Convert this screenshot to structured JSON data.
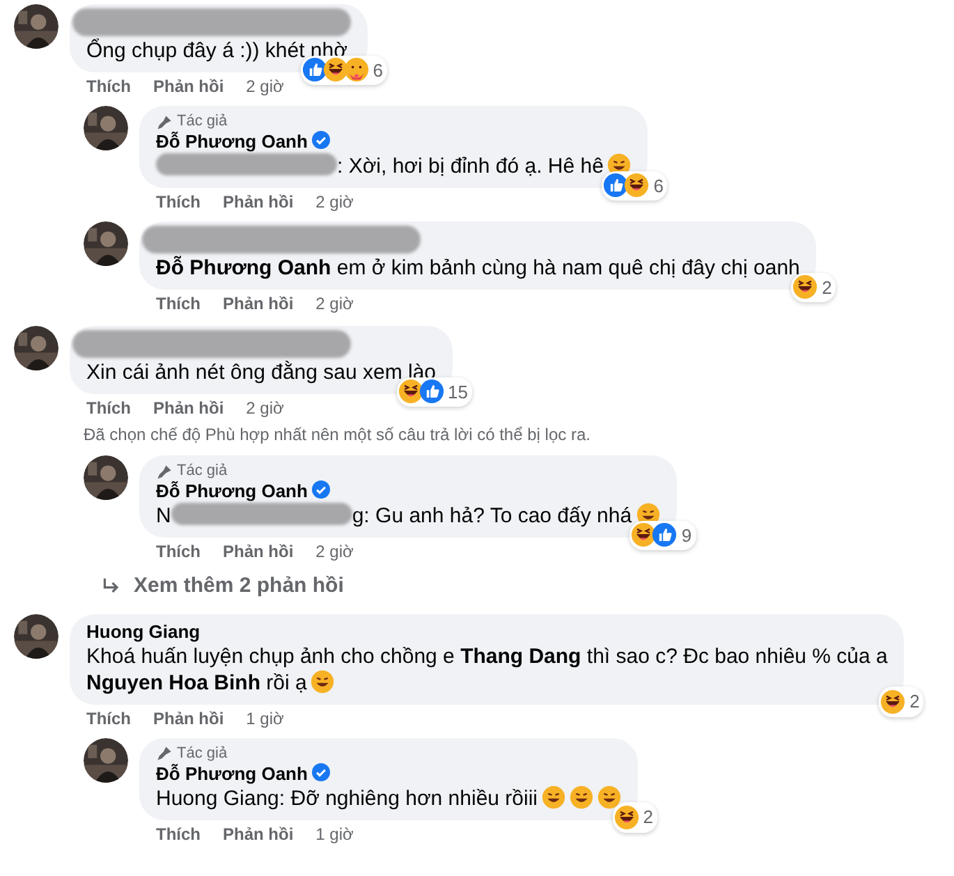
{
  "thread": [
    {
      "author_hidden": true,
      "segments": [
        {
          "kind": "text",
          "text": "Ổng chụp đây á :)) khét nhờ"
        }
      ],
      "reactions": [
        {
          "kind": "like"
        },
        {
          "kind": "haha"
        },
        {
          "kind": "care"
        }
      ],
      "reaction_count": "6",
      "actions": [
        "Thích",
        "Phản hồi"
      ],
      "time": "2 giờ",
      "replies": [
        {
          "author": "Đỗ Phương Oanh",
          "verified": true,
          "badge": "Tác giả",
          "segments": [
            {
              "kind": "blur"
            },
            {
              "kind": "text",
              "text": ": Xời, hơi bị đỉnh đó ạ. Hê hê"
            },
            {
              "kind": "emoji"
            }
          ],
          "reactions": [
            {
              "kind": "like"
            },
            {
              "kind": "haha"
            }
          ],
          "reaction_count": "6",
          "actions": [
            "Thích",
            "Phản hồi"
          ],
          "time": "2 giờ"
        },
        {
          "author_hidden": true,
          "segments": [
            {
              "kind": "text",
              "text": "**Đỗ Phương Oanh** em ở kim bảnh cùng hà nam quê chị đây chị oanh"
            }
          ],
          "reactions": [
            {
              "kind": "haha"
            }
          ],
          "reaction_count": "2",
          "actions": [
            "Thích",
            "Phản hồi"
          ],
          "time": "2 giờ"
        }
      ]
    },
    {
      "author_hidden": true,
      "segments": [
        {
          "kind": "text",
          "text": "Xin cái ảnh nét ông đằng sau xem lào"
        }
      ],
      "reactions": [
        {
          "kind": "haha"
        },
        {
          "kind": "like"
        }
      ],
      "reaction_count": "15",
      "actions": [
        "Thích",
        "Phản hồi"
      ],
      "time": "2 giờ",
      "notice": "Đã chọn chế độ Phù hợp nhất nên một số câu trả lời có thể bị lọc ra.",
      "replies": [
        {
          "author": "Đỗ Phương Oanh",
          "verified": true,
          "badge": "Tác giả",
          "segments": [
            {
              "kind": "text",
              "text": "N"
            },
            {
              "kind": "blur"
            },
            {
              "kind": "text",
              "text": "g: Gu anh hả? To cao đấy nhá"
            },
            {
              "kind": "emoji"
            }
          ],
          "reactions": [
            {
              "kind": "haha"
            },
            {
              "kind": "like"
            }
          ],
          "reaction_count": "9",
          "actions": [
            "Thích",
            "Phản hồi"
          ],
          "time": "2 giờ"
        }
      ],
      "more_replies": "Xem thêm 2 phản hồi"
    },
    {
      "author": "Huong Giang",
      "verified": false,
      "segments": [
        {
          "kind": "text",
          "text": "Khoá huấn luyện chụp ảnh cho chồng e **Thang Dang** thì sao c? Đc bao nhiêu % của a"
        },
        {
          "kind": "newline"
        },
        {
          "kind": "text",
          "text": "**Nguyen Hoa Binh** rồi ạ"
        },
        {
          "kind": "emoji"
        }
      ],
      "reactions": [
        {
          "kind": "haha"
        }
      ],
      "reaction_count": "2",
      "actions": [
        "Thích",
        "Phản hồi"
      ],
      "time": "1 giờ",
      "replies": [
        {
          "author": "Đỗ Phương Oanh",
          "verified": true,
          "badge": "Tác giả",
          "segments": [
            {
              "kind": "text",
              "text": "Huong Giang: Đỡ nghiêng hơn nhiều rồiii"
            },
            {
              "kind": "emoji"
            },
            {
              "kind": "emoji"
            },
            {
              "kind": "emoji"
            }
          ],
          "reactions": [
            {
              "kind": "haha"
            }
          ],
          "reaction_count": "2",
          "actions": [
            "Thích",
            "Phản hồi"
          ],
          "time": "1 giờ"
        }
      ]
    }
  ]
}
